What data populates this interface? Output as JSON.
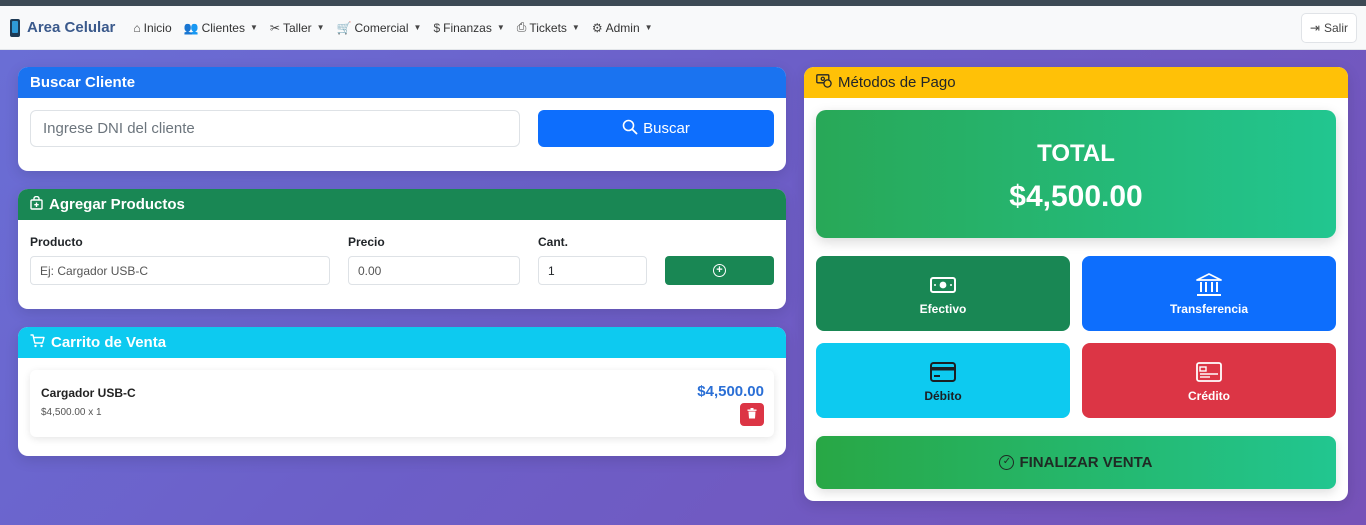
{
  "navbar": {
    "brand": "Area Celular",
    "items": [
      {
        "label": "Inicio",
        "icon": "home-icon",
        "dropdown": false
      },
      {
        "label": "Clientes",
        "icon": "users-icon",
        "dropdown": true
      },
      {
        "label": "Taller",
        "icon": "tools-icon",
        "dropdown": true
      },
      {
        "label": "Comercial",
        "icon": "cart-icon",
        "dropdown": true
      },
      {
        "label": "Finanzas",
        "icon": "cash-icon",
        "dropdown": true
      },
      {
        "label": "Tickets",
        "icon": "printer-icon",
        "dropdown": true
      },
      {
        "label": "Admin",
        "icon": "gear-icon",
        "dropdown": true
      }
    ],
    "logout": "Salir"
  },
  "buscar": {
    "title": "Buscar Cliente",
    "placeholder": "Ingrese DNI del cliente",
    "button": "Buscar"
  },
  "productos": {
    "title": "Agregar Productos",
    "label_producto": "Producto",
    "label_precio": "Precio",
    "label_cant": "Cant.",
    "producto_placeholder": "Ej: Cargador USB-C",
    "precio_placeholder": "0.00",
    "cant_value": "1"
  },
  "carrito": {
    "title": "Carrito de Venta",
    "items": [
      {
        "name": "Cargador USB-C",
        "detail": "$4,500.00 x 1",
        "price": "$4,500.00"
      }
    ]
  },
  "pago": {
    "title": "Métodos de Pago",
    "total_label": "TOTAL",
    "total_value": "$4,500.00",
    "methods": [
      {
        "label": "Efectivo",
        "icon": "cash-icon",
        "color": "#198754"
      },
      {
        "label": "Transferencia",
        "icon": "bank-icon",
        "color": "#0d6efd"
      },
      {
        "label": "Débito",
        "icon": "credit-card-icon",
        "color": "#0dcaf0"
      },
      {
        "label": "Crédito",
        "icon": "card-icon",
        "color": "#dc3545"
      }
    ],
    "finalizar": "FINALIZAR VENTA"
  },
  "colors": {
    "primary": "#0d6efd",
    "success": "#198754",
    "info": "#0dcaf0",
    "warning": "#ffc107",
    "danger": "#dc3545"
  }
}
